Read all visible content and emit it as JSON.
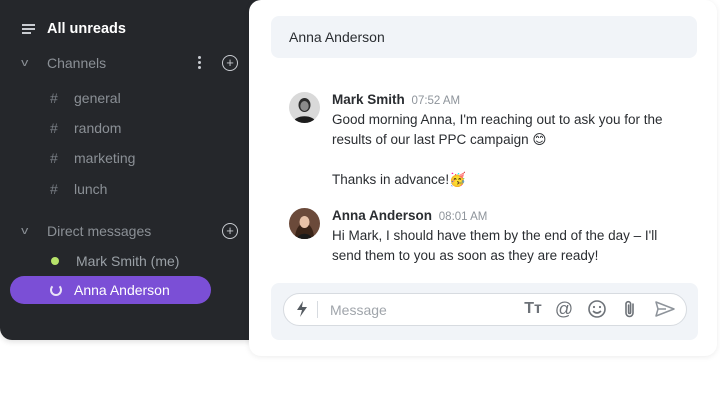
{
  "sidebar": {
    "all_unreads": "All unreads",
    "channels_label": "Channels",
    "channels": [
      {
        "label": "general"
      },
      {
        "label": "random"
      },
      {
        "label": "marketing"
      },
      {
        "label": "lunch"
      }
    ],
    "dm_label": "Direct messages",
    "dms": [
      {
        "label": "Mark Smith (me)",
        "status": "online"
      },
      {
        "label": "Anna Anderson",
        "status": "away",
        "active": true
      }
    ],
    "icons": {
      "hash": "#"
    }
  },
  "chat": {
    "title": "Anna Anderson",
    "messages": [
      {
        "author": "Mark Smith",
        "time": "07:52 AM",
        "lines": [
          "Good morning Anna, I'm reaching out to ask you for the",
          "results of our last PPC campaign 😊",
          "",
          "Thanks in advance!🥳"
        ]
      },
      {
        "author": "Anna Anderson",
        "time": "08:01 AM",
        "lines": [
          "Hi Mark, I should have them by the end of the day – I'll",
          "send them to you as soon as they are ready!"
        ]
      }
    ],
    "composer": {
      "placeholder": "Message",
      "format_glyph": "Tт",
      "mention_glyph": "@"
    }
  },
  "colors": {
    "sidebar_bg": "#25272b",
    "active_item": "#7b4fd6",
    "online": "#b7e36a",
    "panel_bg": "#f1f4f8"
  }
}
